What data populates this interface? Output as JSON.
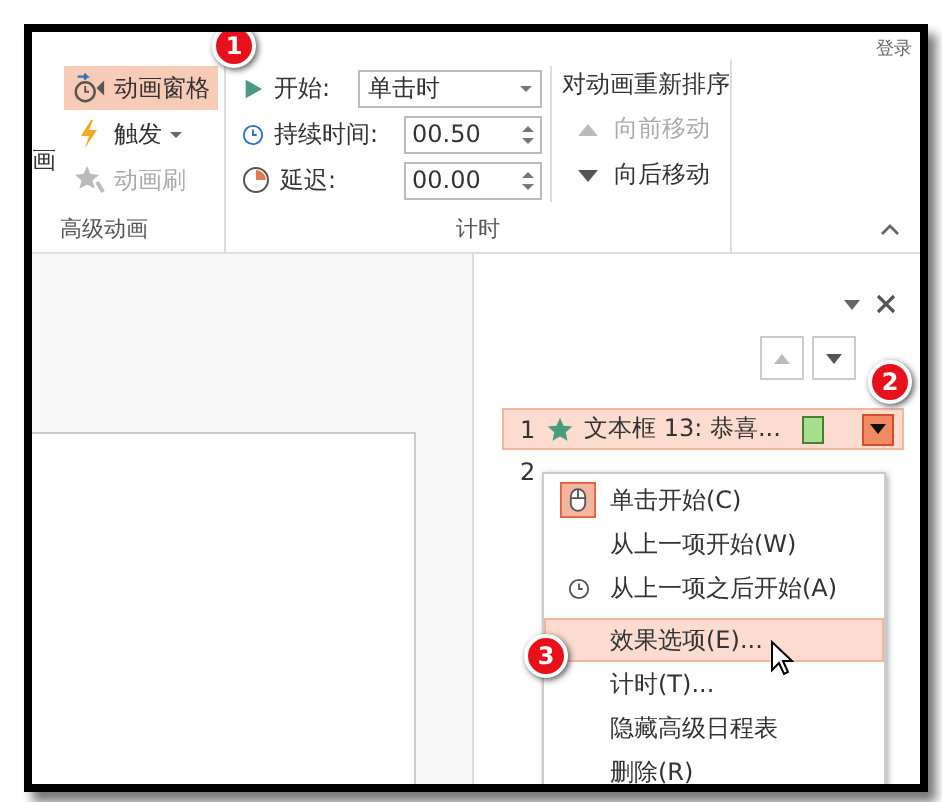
{
  "title_bar": {
    "account": "登录"
  },
  "ribbon": {
    "partial_label": "画",
    "advanced": {
      "label": "高级动画",
      "buttons": [
        {
          "kind": "pane",
          "label": "动画窗格",
          "selected": true,
          "disabled": false,
          "has_menu": false
        },
        {
          "kind": "trigger",
          "label": "触发",
          "selected": false,
          "disabled": false,
          "has_menu": true
        },
        {
          "kind": "painter",
          "label": "动画刷",
          "selected": false,
          "disabled": true,
          "has_menu": false
        }
      ]
    },
    "timing": {
      "label": "计时",
      "fields": [
        {
          "kind": "dropdown",
          "label": "开始:",
          "value": "单击时"
        },
        {
          "kind": "spinner",
          "label": "持续时间:",
          "value": "00.50"
        },
        {
          "kind": "spinner",
          "label": "延迟:",
          "value": "00.00"
        }
      ],
      "reorder": {
        "label": "对动画重新排序",
        "buttons": [
          {
            "kind": "up",
            "label": "向前移动",
            "disabled": true
          },
          {
            "kind": "down",
            "label": "向后移动",
            "disabled": false
          }
        ]
      }
    }
  },
  "animation_pane": {
    "move_buttons": [
      {
        "kind": "up",
        "disabled": true
      },
      {
        "kind": "down",
        "disabled": false
      }
    ],
    "items": [
      {
        "number": "1",
        "name": "文本框 13: 恭喜...",
        "selected": true
      },
      {
        "number": "2",
        "selected": false
      }
    ],
    "context_menu": [
      {
        "label": "单击开始(C)",
        "selected": false
      },
      {
        "label": "从上一项开始(W)",
        "selected": false
      },
      {
        "label": "从上一项之后开始(A)",
        "selected": false
      },
      {
        "label": "效果选项(E)...",
        "selected": true
      },
      {
        "label": "计时(T)...",
        "selected": false
      },
      {
        "label": "隐藏高级日程表",
        "selected": false
      },
      {
        "label": "删除(R)",
        "selected": false
      }
    ]
  },
  "callouts": [
    {
      "number": "1"
    },
    {
      "number": "2"
    },
    {
      "number": "3"
    }
  ]
}
